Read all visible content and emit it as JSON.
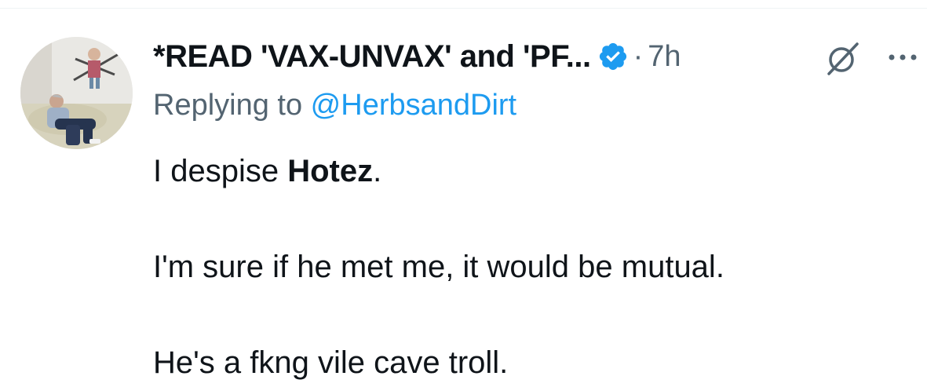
{
  "tweet": {
    "author": {
      "display_name": "*READ 'VAX-UNVAX' and 'PF...",
      "verified": true,
      "avatar_icon": "profile-photo"
    },
    "separator": "·",
    "timestamp": "7h",
    "reply": {
      "prefix": "Replying to ",
      "handle": "@HerbsandDirt"
    },
    "body": {
      "line1_pre": "I despise ",
      "line1_bold": "Hotez",
      "line1_post": ".",
      "line2": "I'm sure if he met me, it would be mutual.",
      "line3": "He's a fkng vile cave troll."
    },
    "icons": {
      "grok": "grok-icon",
      "more": "more-icon",
      "verified": "verified-badge-icon"
    }
  },
  "colors": {
    "primary_text": "#0f1419",
    "secondary_text": "#536471",
    "link": "#1d9bf0",
    "verified": "#1d9bf0"
  }
}
